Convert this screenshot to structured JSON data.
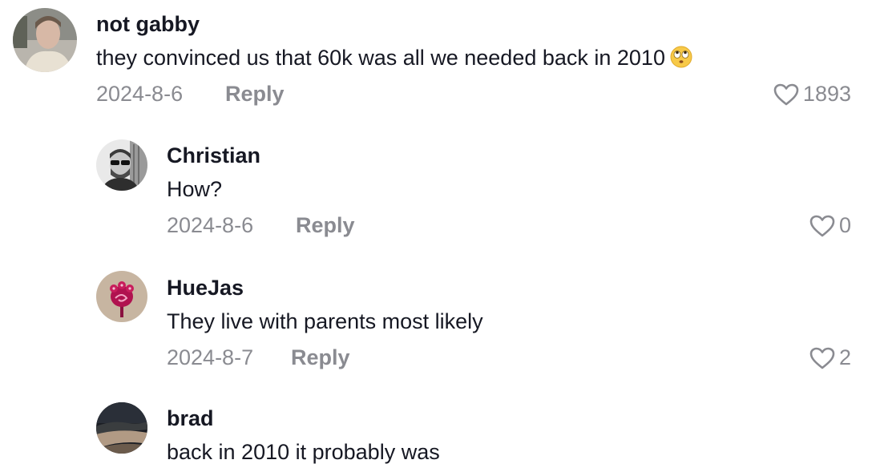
{
  "comments": [
    {
      "username": "not gabby",
      "text": "they convinced us that 60k was all we needed back in 2010",
      "emoji": "face-with-rolling-eyes",
      "date": "2024-8-6",
      "reply_label": "Reply",
      "likes": "1893"
    },
    {
      "username": "Christian",
      "text": "How?",
      "date": "2024-8-6",
      "reply_label": "Reply",
      "likes": "0"
    },
    {
      "username": "HueJas",
      "text": "They live with parents most likely",
      "date": "2024-8-7",
      "reply_label": "Reply",
      "likes": "2"
    },
    {
      "username": "brad",
      "text": "back in 2010 it probably was"
    }
  ],
  "colors": {
    "primary_text": "#161823",
    "secondary_text": "#8a8b91",
    "background": "#ffffff"
  }
}
